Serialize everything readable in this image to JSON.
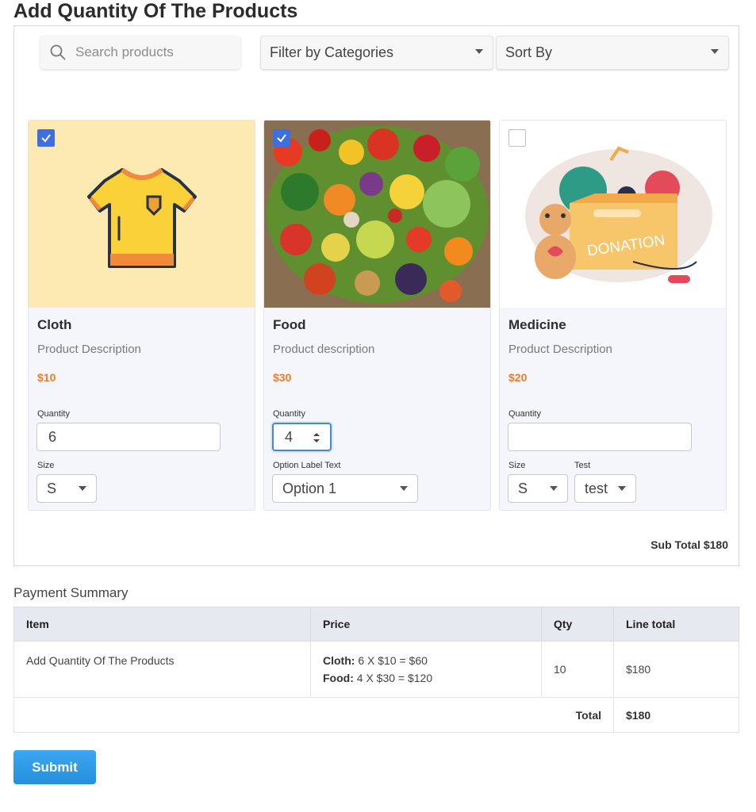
{
  "page": {
    "title": "Add Quantity Of The Products"
  },
  "toolbar": {
    "search_placeholder": "Search products",
    "filter_label": "Filter by Categories",
    "sort_label": "Sort By"
  },
  "products": [
    {
      "name": "Cloth",
      "description": "Product Description",
      "price": "$10",
      "checked": true,
      "quantity_label": "Quantity",
      "quantity": "6",
      "option_labels": [
        "Size"
      ],
      "option_values": [
        "S"
      ]
    },
    {
      "name": "Food",
      "description": "Product description",
      "price": "$30",
      "checked": true,
      "quantity_label": "Quantity",
      "quantity": "4",
      "option_labels": [
        "Option Label Text"
      ],
      "option_values": [
        "Option 1"
      ]
    },
    {
      "name": "Medicine",
      "description": "Product Description",
      "price": "$20",
      "checked": false,
      "quantity_label": "Quantity",
      "quantity": "",
      "option_labels": [
        "Size",
        "Test"
      ],
      "option_values": [
        "S",
        "test"
      ],
      "image_text": "DONATION"
    }
  ],
  "subtotal": "Sub Total $180",
  "payment": {
    "title": "Payment Summary",
    "headers": [
      "Item",
      "Price",
      "Qty",
      "Line total"
    ],
    "item": "Add Quantity Of The Products",
    "price_lines": [
      {
        "label": "Cloth:",
        "text": "6 X $10 = $60"
      },
      {
        "label": "Food:",
        "text": "4 X $30 = $120"
      }
    ],
    "qty": "10",
    "line_total": "$180",
    "total_label": "Total",
    "total_value": "$180"
  },
  "submit_label": "Submit",
  "colors": {
    "accent": "#3d6fe0",
    "price": "#f07a2a",
    "submit": "#2f9ce6"
  }
}
